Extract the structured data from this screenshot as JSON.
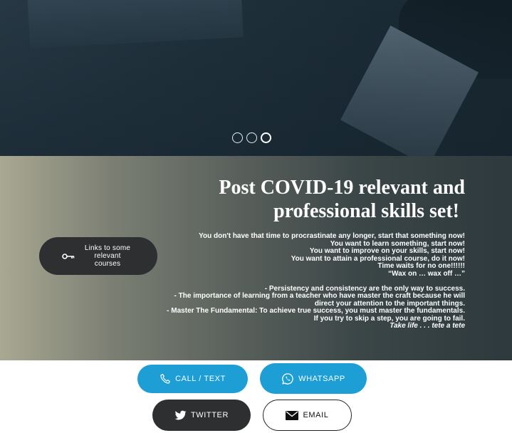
{
  "slider": {
    "dots": [
      {
        "label": "slide 1",
        "active": false
      },
      {
        "label": "slide 2",
        "active": false
      },
      {
        "label": "slide 3",
        "active": true
      }
    ]
  },
  "info": {
    "title_line1": "Post COVID-19 relevant and",
    "title_line2": "professional skills set!",
    "courses_button_label": "Links to some relevant courses",
    "paragraph1": [
      "You don't have that time to procrastinate any longer, start that something now!",
      "You want to learn something, start now!",
      "You want to improve on your skills, start now!",
      "You want to attain a professional course, do it now!",
      "Time waits for no one!!!!!!",
      "“Wax on … wax off …”"
    ],
    "paragraph2": [
      "- Persistency and consistency are the only way to success.",
      "- The importance of learning from a teacher who have master the craft because he will direct your attention to the important things.",
      "- Master The Fundamental: To achieve true success, you must master the fundamentals.",
      "If you try to skip a step, you are going to fail."
    ],
    "signoff": "Take life . . . tete a tete"
  },
  "contact": {
    "call_label": "CALL / TEXT",
    "whatsapp_label": "WHATSAPP",
    "twitter_label": "TWITTER",
    "email_label": "EMAIL"
  },
  "colors": {
    "accent_blue": "#1d9fd6",
    "dark_button": "#2d2f30",
    "hero_bg": "#22333e"
  },
  "icons": [
    "key-icon",
    "phone-icon",
    "whatsapp-icon",
    "twitter-icon",
    "envelope-icon"
  ]
}
